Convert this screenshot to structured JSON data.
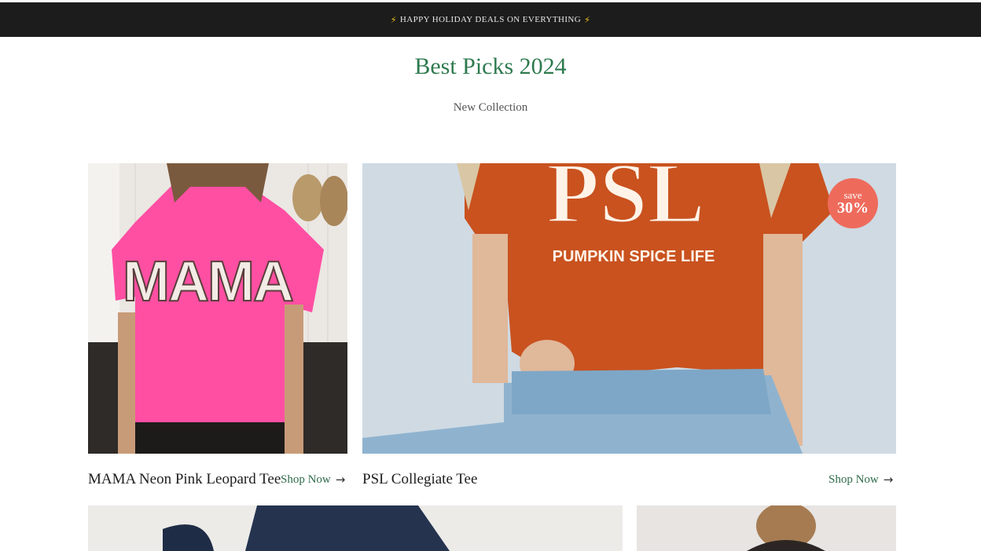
{
  "announcement": {
    "text": "HAPPY HOLIDAY DEALS ON EVERYTHING",
    "icon": "lightning-bolt-icon"
  },
  "header": {
    "title": "Best Picks 2024",
    "subtitle": "New Collection"
  },
  "products": [
    {
      "name": "MAMA Neon Pink Leopard Tee",
      "link": "Shop Now",
      "shirt_text": "MAMA",
      "shirt_color": "#ff4fa3"
    },
    {
      "name": "PSL Collegiate Tee",
      "link": "Shop Now",
      "shirt_text_big": "PSL",
      "shirt_text_small": "PUMPKIN SPICE LIFE",
      "shirt_color": "#c9521f",
      "badge": {
        "label": "save",
        "value": "30%"
      }
    }
  ],
  "colors": {
    "accent": "#2e7a4f",
    "badge": "#ee6b5c",
    "announce_bg": "#1c1c1c"
  }
}
